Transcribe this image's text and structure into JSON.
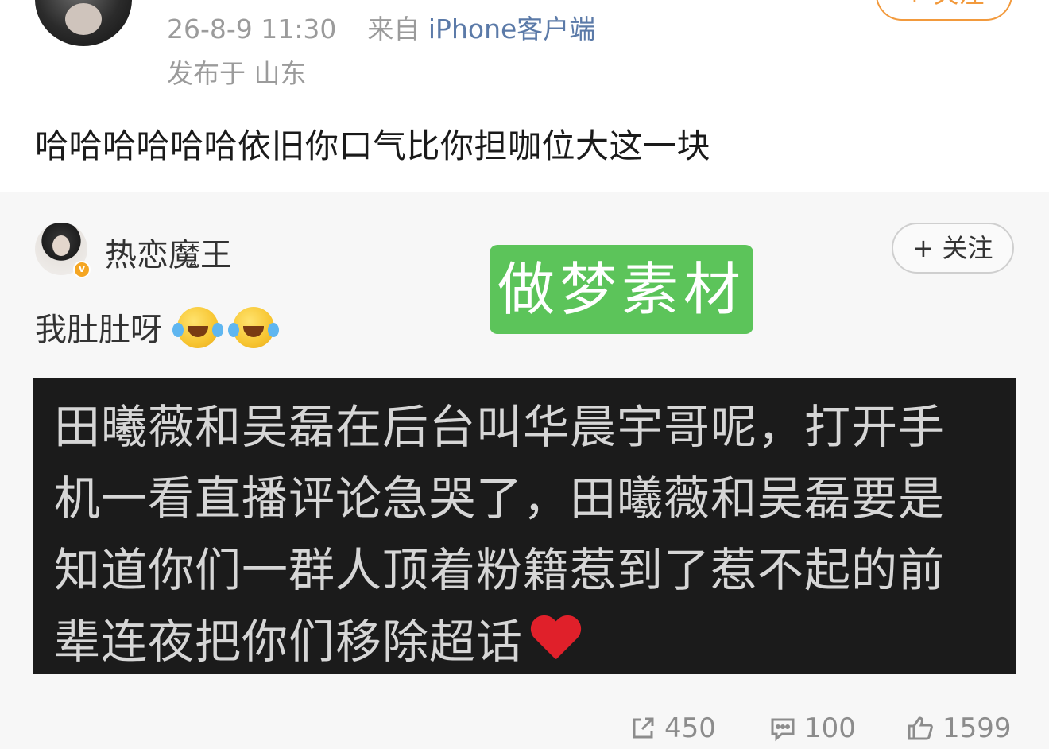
{
  "post": {
    "timestamp": "26-8-9 11:30",
    "from_prefix": "来自",
    "source": "iPhone客户端",
    "location": "发布于 山东",
    "follow_label": "+ 关注",
    "text": "哈哈哈哈哈哈依旧你口气比你担咖位大这一块"
  },
  "quoted": {
    "username": "热恋魔王",
    "follow_label": "+ 关注",
    "text": "我肚肚呀",
    "watermark": "做梦素材",
    "image_lines": [
      "田曦薇和吴磊在后台叫华晨宇哥呢，打开手",
      "机一看直播评论急哭了，田曦薇和吴磊要是",
      "知道你们一群人顶着粉籍惹到了惹不起的前",
      "辈连夜把你们移除超话"
    ],
    "reposts": "450",
    "comments": "100",
    "likes": "1599"
  },
  "colors": {
    "accent": "#f29a3d",
    "source_link": "#5b7aa8",
    "watermark_bg": "#5cc45a"
  }
}
